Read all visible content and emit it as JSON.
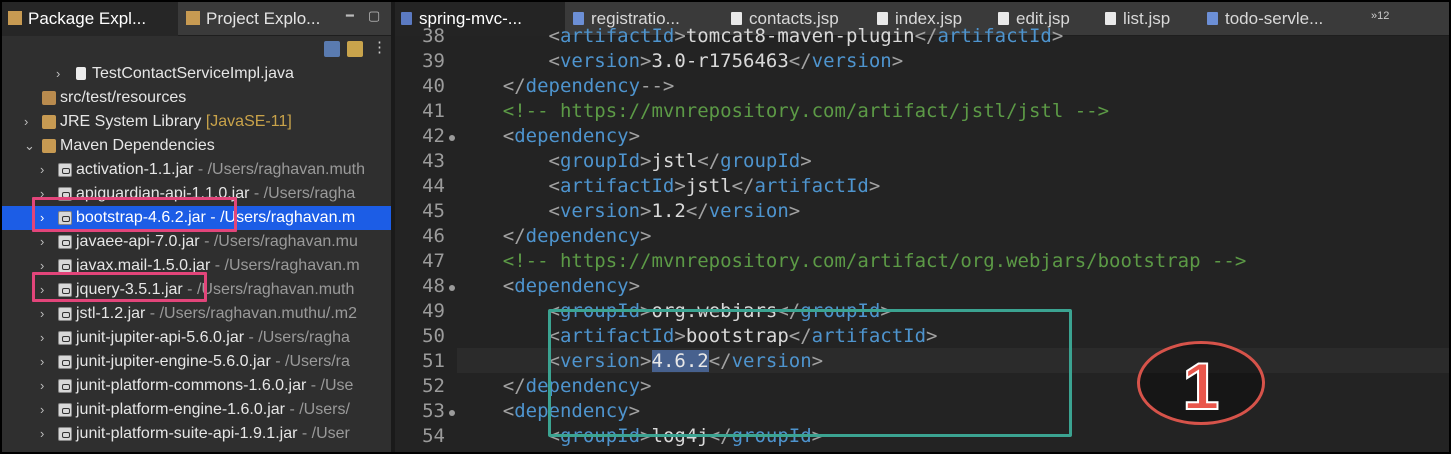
{
  "left_panel": {
    "tabs": [
      {
        "label": "Package Expl..."
      },
      {
        "label": "Project Explo..."
      }
    ],
    "tree": [
      {
        "label": "TestContactServiceImpl.java",
        "path": ""
      },
      {
        "label": "src/test/resources",
        "path": ""
      },
      {
        "label": "JRE System Library",
        "path": "[JavaSE-11]"
      },
      {
        "label": "Maven Dependencies",
        "path": ""
      },
      {
        "label": "activation-1.1.jar",
        "path": " - /Users/raghavan.muth"
      },
      {
        "label": "apiguardian-api-1.1.0.jar",
        "path": " - /Users/ragha"
      },
      {
        "label": "bootstrap-4.6.2.jar",
        "path": " - /Users/raghavan.m"
      },
      {
        "label": "javaee-api-7.0.jar",
        "path": " - /Users/raghavan.mu"
      },
      {
        "label": "javax.mail-1.5.0.jar",
        "path": " - /Users/raghavan.m"
      },
      {
        "label": "jquery-3.5.1.jar",
        "path": " - /Users/raghavan.muth"
      },
      {
        "label": "jstl-1.2.jar",
        "path": " - /Users/raghavan.muthu/.m2"
      },
      {
        "label": "junit-jupiter-api-5.6.0.jar",
        "path": " - /Users/ragha"
      },
      {
        "label": "junit-jupiter-engine-5.6.0.jar",
        "path": " - /Users/ra"
      },
      {
        "label": "junit-platform-commons-1.6.0.jar",
        "path": " - /Use"
      },
      {
        "label": "junit-platform-engine-1.6.0.jar",
        "path": " - /Users/"
      },
      {
        "label": "junit-platform-suite-api-1.9.1.jar",
        "path": " - /User"
      }
    ]
  },
  "editor": {
    "tabs": [
      {
        "label": "spring-mvc-..."
      },
      {
        "label": "registratio..."
      },
      {
        "label": "contacts.jsp"
      },
      {
        "label": "index.jsp"
      },
      {
        "label": "edit.jsp"
      },
      {
        "label": "list.jsp"
      },
      {
        "label": "todo-servle..."
      }
    ],
    "overflow_label": "»12",
    "lines": [
      {
        "num": "38",
        "indent": "        ",
        "a": "<",
        "tag": "artifactId",
        "b": ">",
        "text": "tomcat8-maven-plugin",
        "c": "</",
        "tag2": "artifactId",
        "d": ">"
      },
      {
        "num": "39",
        "indent": "        ",
        "a": "<",
        "tag": "version",
        "b": ">",
        "text": "3.0-r1756463",
        "c": "</",
        "tag2": "version",
        "d": ">"
      },
      {
        "num": "40",
        "indent": "    ",
        "a": "</",
        "tag": "dependency",
        "b": "-->",
        "text": "",
        "c": "",
        "tag2": "",
        "d": ""
      },
      {
        "num": "41",
        "indent": "    ",
        "comment": "<!-- https://mvnrepository.com/artifact/jstl/jstl -->"
      },
      {
        "num": "42",
        "indent": "    ",
        "a": "<",
        "tag": "dependency",
        "b": ">",
        "text": "",
        "c": "",
        "tag2": "",
        "d": ""
      },
      {
        "num": "43",
        "indent": "        ",
        "a": "<",
        "tag": "groupId",
        "b": ">",
        "text": "jstl",
        "c": "</",
        "tag2": "groupId",
        "d": ">"
      },
      {
        "num": "44",
        "indent": "        ",
        "a": "<",
        "tag": "artifactId",
        "b": ">",
        "text": "jstl",
        "c": "</",
        "tag2": "artifactId",
        "d": ">"
      },
      {
        "num": "45",
        "indent": "        ",
        "a": "<",
        "tag": "version",
        "b": ">",
        "text": "1.2",
        "c": "</",
        "tag2": "version",
        "d": ">"
      },
      {
        "num": "46",
        "indent": "    ",
        "a": "</",
        "tag": "dependency",
        "b": ">",
        "text": "",
        "c": "",
        "tag2": "",
        "d": ""
      },
      {
        "num": "47",
        "indent": "    ",
        "comment": "<!-- https://mvnrepository.com/artifact/org.webjars/bootstrap -->"
      },
      {
        "num": "48",
        "indent": "    ",
        "a": "<",
        "tag": "dependency",
        "b": ">",
        "text": "",
        "c": "",
        "tag2": "",
        "d": ""
      },
      {
        "num": "49",
        "indent": "        ",
        "a": "<",
        "tag": "groupId",
        "b": ">",
        "text": "org.webjars",
        "c": "</",
        "tag2": "groupId",
        "d": ">"
      },
      {
        "num": "50",
        "indent": "        ",
        "a": "<",
        "tag": "artifactId",
        "b": ">",
        "text": "bootstrap",
        "c": "</",
        "tag2": "artifactId",
        "d": ">"
      },
      {
        "num": "51",
        "indent": "        ",
        "a": "<",
        "tag": "version",
        "b": ">",
        "text": "4.6.2",
        "c": "</",
        "tag2": "version",
        "d": ">"
      },
      {
        "num": "52",
        "indent": "    ",
        "a": "</",
        "tag": "dependency",
        "b": ">",
        "text": "",
        "c": "",
        "tag2": "",
        "d": ""
      },
      {
        "num": "53",
        "indent": "    ",
        "a": "<",
        "tag": "dependency",
        "b": ">",
        "text": "",
        "c": "",
        "tag2": "",
        "d": ""
      },
      {
        "num": "54",
        "indent": "        ",
        "a": "<",
        "tag": "groupId",
        "b": ">",
        "text": "log4j",
        "c": "</",
        "tag2": "groupId",
        "d": ">"
      }
    ]
  },
  "annotation": {
    "number": "1"
  },
  "colors": {
    "selection": "#1c5de6",
    "tag": "#4e94ce",
    "comment": "#5c9a46",
    "highlight_pink": "#e2457a",
    "highlight_teal": "#3ba391",
    "badge_red": "#e9564b"
  }
}
